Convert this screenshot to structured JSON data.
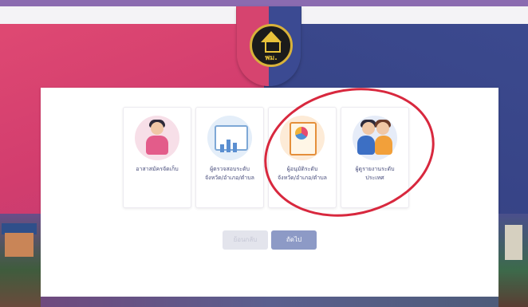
{
  "header": {
    "logo": {
      "text": "พม.",
      "icon": "ministry-logo-icon"
    }
  },
  "options": [
    {
      "label_lines": [
        "อาสาสมัครจัดเก็บ"
      ],
      "icon": "volunteer-illustration-icon",
      "selected": false
    },
    {
      "label_lines": [
        "ผู้ตรวจสอบระดับ",
        "จังหวัด/อำเภอ/ตำบล"
      ],
      "icon": "inspector-illustration-icon",
      "selected": false
    },
    {
      "label_lines": [
        "ผู้อนุมัติระดับ",
        "จังหวัด/อำเภอ/ตำบล"
      ],
      "icon": "approver-illustration-icon",
      "selected": true
    },
    {
      "label_lines": [
        "ผู้ดูรายงานระดับ",
        "ประเทศ"
      ],
      "icon": "national-report-viewer-illustration-icon",
      "selected": false
    }
  ],
  "buttons": {
    "back_label": "ย้อนกลับ",
    "next_label": "ถัดไป"
  },
  "colors": {
    "brand_pink": "#d6446f",
    "brand_blue": "#3b4a92",
    "accent": "#8d9ac6",
    "annotation": "#d8283e"
  }
}
